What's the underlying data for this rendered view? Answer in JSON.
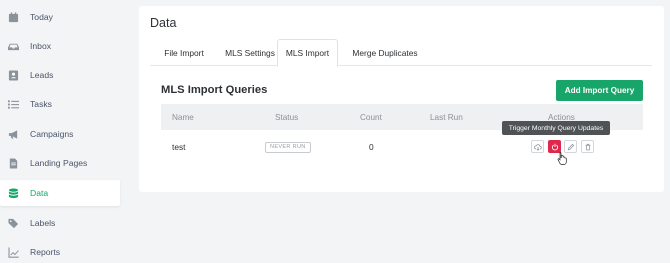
{
  "sidebar": {
    "items": [
      {
        "label": "Today",
        "icon": "calendar-icon"
      },
      {
        "label": "Inbox",
        "icon": "inbox-icon"
      },
      {
        "label": "Leads",
        "icon": "contact-card-icon"
      },
      {
        "label": "Tasks",
        "icon": "list-icon"
      },
      {
        "label": "Campaigns",
        "icon": "megaphone-icon"
      },
      {
        "label": "Landing Pages",
        "icon": "file-icon"
      },
      {
        "label": "Data",
        "icon": "database-icon",
        "active": true
      },
      {
        "label": "Labels",
        "icon": "tags-icon"
      },
      {
        "label": "Reports",
        "icon": "chart-line-icon"
      }
    ]
  },
  "main": {
    "title": "Data",
    "tabs": [
      {
        "label": "File Import"
      },
      {
        "label": "MLS Settings"
      },
      {
        "label": "MLS Import",
        "active": true
      },
      {
        "label": "Merge Duplicates"
      }
    ],
    "section_title": "MLS Import Queries",
    "add_button": "Add Import Query",
    "table": {
      "columns": [
        "Name",
        "Status",
        "Count",
        "Last Run",
        "Actions"
      ],
      "rows": [
        {
          "name": "test",
          "status": "NEVER RUN",
          "count": "0",
          "last_run": ""
        }
      ]
    },
    "tooltip": "Trigger Monthly Query Updates"
  },
  "colors": {
    "accent": "#18a56a",
    "danger": "#e0284c",
    "tooltip_bg": "#4f5356"
  }
}
